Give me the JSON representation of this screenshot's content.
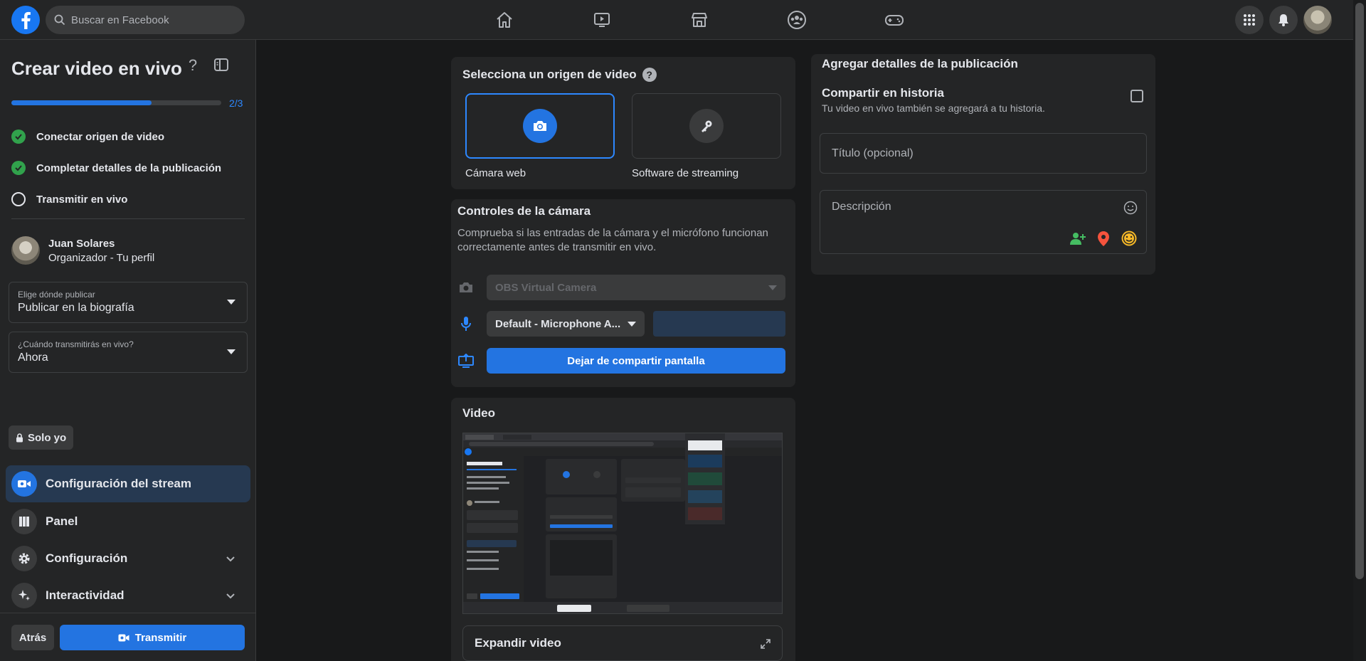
{
  "topbar": {
    "search_placeholder": "Buscar en Facebook",
    "nav_icons": [
      "home-icon",
      "watch-icon",
      "marketplace-icon",
      "groups-icon",
      "gaming-icon"
    ],
    "right_icons": [
      "menu-grid-icon",
      "notifications-icon",
      "profile-avatar"
    ]
  },
  "sidebar": {
    "title": "Crear video en vivo",
    "progress": {
      "value": 0.667,
      "label": "2/3"
    },
    "steps": [
      {
        "label": "Conectar origen de video",
        "done": true
      },
      {
        "label": "Completar detalles de la publicación",
        "done": true
      },
      {
        "label": "Transmitir en vivo",
        "done": false
      }
    ],
    "user": {
      "name": "Juan Solares",
      "role": "Organizador - Tu perfil"
    },
    "where": {
      "label": "Elige dónde publicar",
      "value": "Publicar en la biografía"
    },
    "when": {
      "label": "¿Cuándo transmitirás en vivo?",
      "value": "Ahora"
    },
    "privacy": "Solo yo",
    "menu": [
      {
        "label": "Configuración del stream",
        "icon": "live-camera-icon",
        "active": true
      },
      {
        "label": "Panel",
        "icon": "dashboard-icon"
      },
      {
        "label": "Configuración",
        "icon": "gear-icon",
        "expandable": true
      },
      {
        "label": "Interactividad",
        "icon": "sparkle-icon",
        "expandable": true
      }
    ],
    "back_label": "Atrás",
    "stream_label": "Transmitir"
  },
  "source": {
    "title": "Selecciona un origen de video",
    "options": [
      {
        "label": "Cámara web",
        "icon": "camera-icon",
        "selected": true
      },
      {
        "label": "Software de streaming",
        "icon": "key-icon",
        "selected": false
      }
    ]
  },
  "camera": {
    "title": "Controles de la cámara",
    "description": "Comprueba si las entradas de la cámara y el micrófono funcionan correctamente antes de transmitir en vivo.",
    "camera_select": "OBS Virtual Camera",
    "mic_select": "Default - Microphone A...",
    "share_button": "Dejar de compartir pantalla"
  },
  "video": {
    "title": "Video",
    "expand_label": "Expandir video"
  },
  "details": {
    "title": "Agregar detalles de la publicación",
    "story_title": "Compartir en historia",
    "story_sub": "Tu video en vivo también se agregará a tu historia.",
    "title_placeholder": "Título (opcional)",
    "description_placeholder": "Descripción"
  },
  "colors": {
    "accent": "#2374e1",
    "success": "#31a24c",
    "background": "#18191a",
    "surface": "#242526"
  }
}
